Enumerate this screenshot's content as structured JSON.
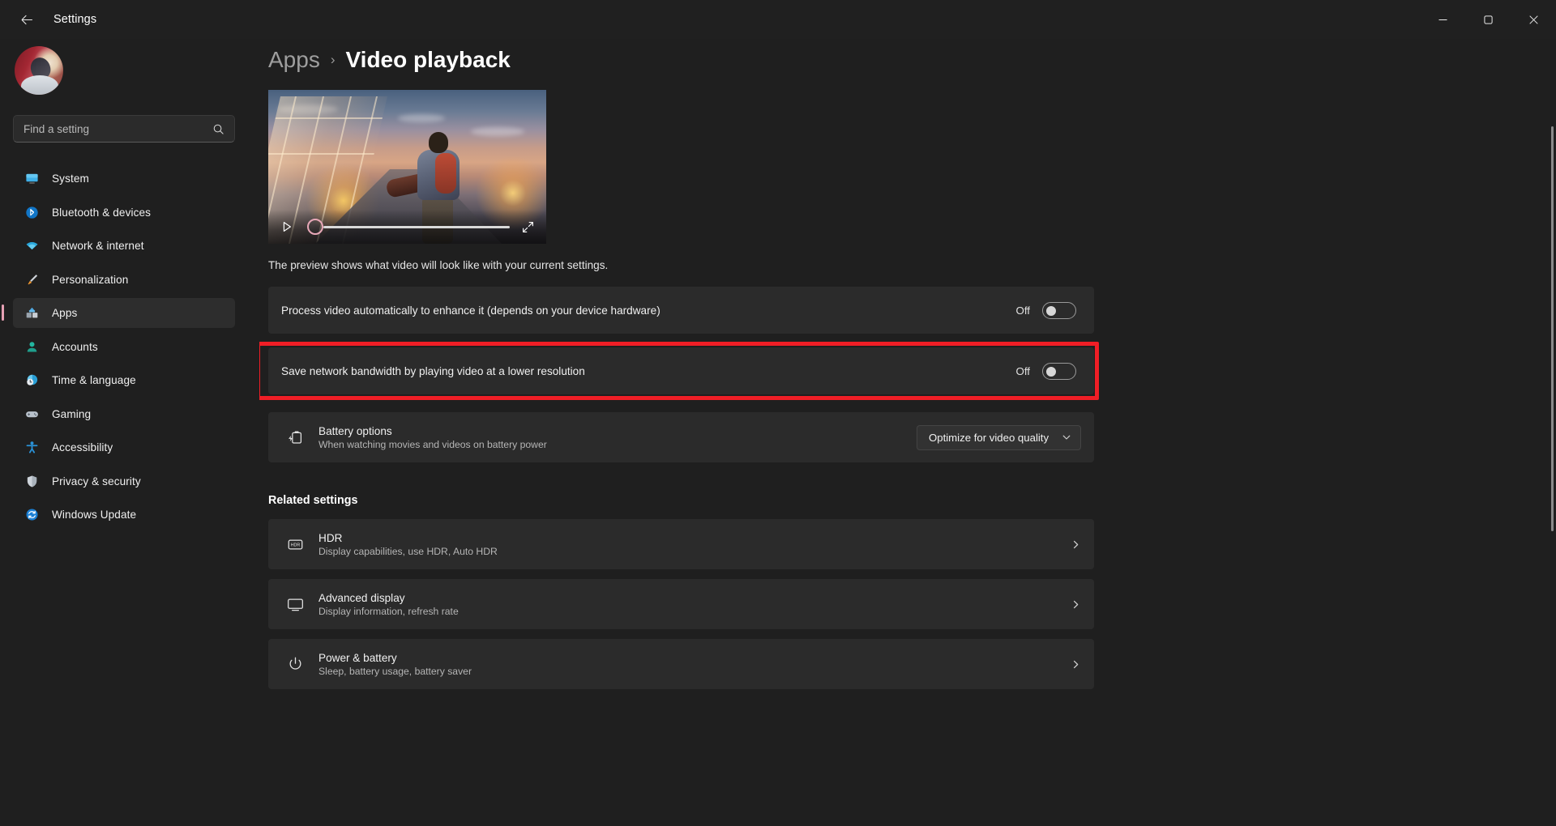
{
  "window": {
    "title": "Settings",
    "back_icon": "back-arrow-icon",
    "minimize_label": "─",
    "maximize_label": "❐",
    "close_label": "✕"
  },
  "sidebar": {
    "avatar_name": "user-avatar",
    "search": {
      "placeholder": "Find a setting",
      "value": "",
      "icon": "search-icon"
    },
    "items": [
      {
        "label": "System",
        "icon": "system-icon",
        "active": false
      },
      {
        "label": "Bluetooth & devices",
        "icon": "bluetooth-icon",
        "active": false
      },
      {
        "label": "Network & internet",
        "icon": "network-icon",
        "active": false
      },
      {
        "label": "Personalization",
        "icon": "paintbrush-icon",
        "active": false
      },
      {
        "label": "Apps",
        "icon": "apps-icon",
        "active": true
      },
      {
        "label": "Accounts",
        "icon": "account-icon",
        "active": false
      },
      {
        "label": "Time & language",
        "icon": "clock-icon",
        "active": false
      },
      {
        "label": "Gaming",
        "icon": "gamepad-icon",
        "active": false
      },
      {
        "label": "Accessibility",
        "icon": "accessibility-icon",
        "active": false
      },
      {
        "label": "Privacy & security",
        "icon": "shield-icon",
        "active": false
      },
      {
        "label": "Windows Update",
        "icon": "windows-update-icon",
        "active": false
      }
    ]
  },
  "breadcrumb": {
    "parent": "Apps",
    "separator": "›",
    "current": "Video playback"
  },
  "video_preview": {
    "play_icon": "play-icon",
    "fullscreen_icon": "fullscreen-icon",
    "seek_position_percent": 0,
    "thumb_color": "#e8a8b8",
    "caption": "The preview shows what video will look like with your current settings."
  },
  "settings": {
    "process_video": {
      "label": "Process video automatically to enhance it (depends on your device hardware)",
      "state": "Off"
    },
    "save_bandwidth": {
      "label": "Save network bandwidth by playing video at a lower resolution",
      "state": "Off",
      "highlighted": true
    },
    "battery_options": {
      "title": "Battery options",
      "subtitle": "When watching movies and videos on battery power",
      "icon": "battery-icon",
      "dropdown_value": "Optimize for video quality",
      "dropdown_icon": "chevron-down-icon"
    }
  },
  "related": {
    "heading": "Related settings",
    "items": [
      {
        "title": "HDR",
        "subtitle": "Display capabilities, use HDR, Auto HDR",
        "icon": "hdr-icon",
        "chevron": "chevron-right-icon"
      },
      {
        "title": "Advanced display",
        "subtitle": "Display information, refresh rate",
        "icon": "monitor-icon",
        "chevron": "chevron-right-icon"
      },
      {
        "title": "Power & battery",
        "subtitle": "Sleep, battery usage, battery saver",
        "icon": "power-icon",
        "chevron": "chevron-right-icon"
      }
    ]
  },
  "colors": {
    "accent": "#e6a0b4",
    "annotation": "#f01e26",
    "card": "#2b2b2b",
    "background": "#1f1f1f"
  }
}
